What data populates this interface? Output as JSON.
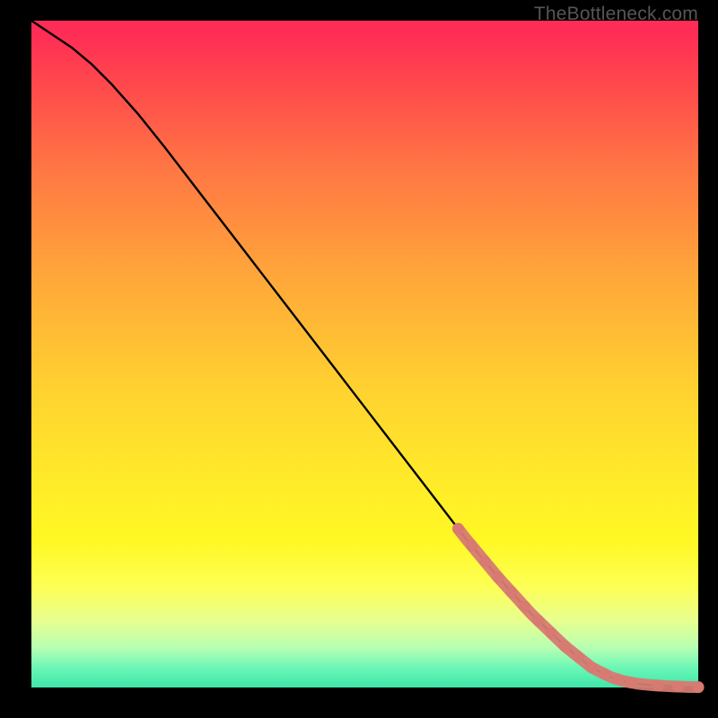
{
  "watermark": "TheBottleneck.com",
  "colors": {
    "curve": "#000000",
    "marker": "#d77a72",
    "gradient_top": "#ff2d55",
    "gradient_bottom": "#3fe6a9"
  },
  "chart_data": {
    "type": "line",
    "title": "",
    "xlabel": "",
    "ylabel": "",
    "xlim": [
      0,
      100
    ],
    "ylim": [
      0,
      100
    ],
    "highlight_x_range": [
      64,
      100
    ],
    "series": [
      {
        "name": "main-curve",
        "x": [
          0,
          3,
          6,
          9,
          12,
          16,
          20,
          25,
          30,
          35,
          40,
          45,
          50,
          55,
          60,
          65,
          70,
          75,
          80,
          84,
          87,
          89,
          91,
          93,
          95,
          97,
          98.5,
          100
        ],
        "y": [
          100,
          98,
          96,
          93.5,
          90.5,
          86,
          81,
          74.5,
          68,
          61.5,
          55,
          48.5,
          42,
          35.5,
          29,
          22.5,
          16.5,
          11,
          6.2,
          3.0,
          1.5,
          0.9,
          0.55,
          0.35,
          0.22,
          0.13,
          0.08,
          0.05
        ]
      }
    ],
    "markers": {
      "name": "highlighted-points",
      "x": [
        64,
        66,
        68,
        70,
        72,
        74,
        76,
        78,
        80,
        82,
        84,
        86,
        88,
        90,
        94,
        97,
        100
      ],
      "r": [
        6.5,
        6.5,
        6.5,
        6.5,
        6.5,
        6.5,
        6.5,
        6.5,
        6.5,
        6.5,
        6.5,
        6.5,
        6.5,
        6.5,
        6.5,
        6.5,
        6.5
      ]
    }
  }
}
